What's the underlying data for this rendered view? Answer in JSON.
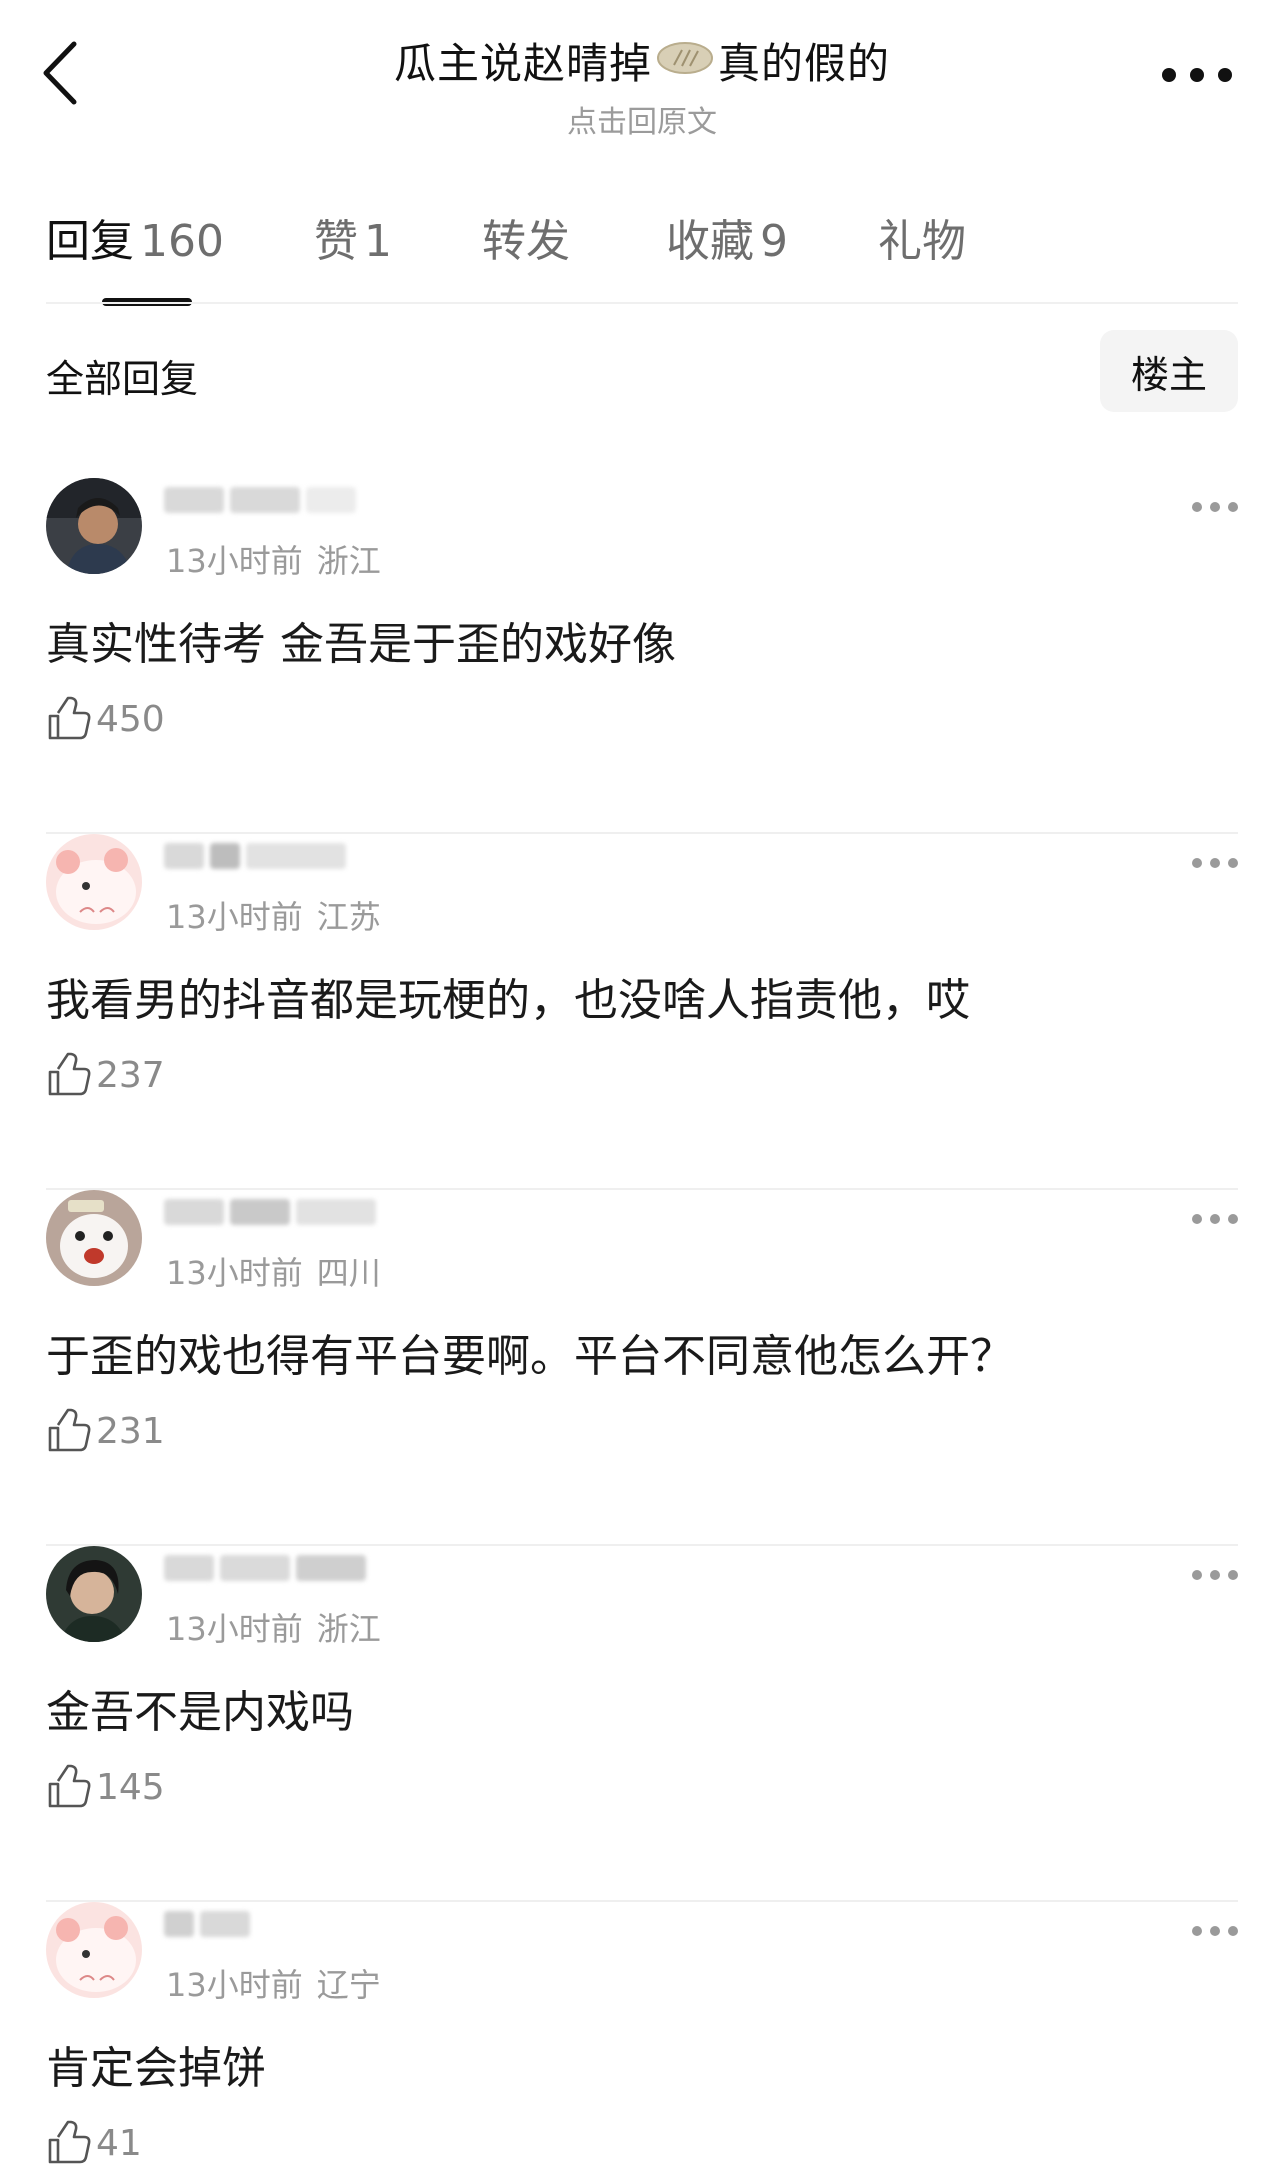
{
  "header": {
    "title_part1": "瓜主说赵晴掉",
    "title_icon": "bread-icon",
    "title_part2": "真的假的",
    "subtitle": "点击回原文"
  },
  "tabs": [
    {
      "label": "回复",
      "count": "160",
      "active": true
    },
    {
      "label": "赞",
      "count": "1"
    },
    {
      "label": "转发",
      "count": ""
    },
    {
      "label": "收藏",
      "count": "9"
    },
    {
      "label": "礼物",
      "count": ""
    }
  ],
  "filter": {
    "title": "全部回复",
    "op_button": "楼主"
  },
  "comments": [
    {
      "time": "13小时前",
      "location": "浙江",
      "text": "真实性待考 金吾是于歪的戏好像",
      "likes": "450",
      "avatar_icon": "person-photo-avatar"
    },
    {
      "time": "13小时前",
      "location": "江苏",
      "text": "我看男的抖音都是玩梗的，也没啥人指责他，哎",
      "likes": "237",
      "avatar_icon": "cartoon-bear-avatar"
    },
    {
      "time": "13小时前",
      "location": "四川",
      "text": "于歪的戏也得有平台要啊。平台不同意他怎么开？",
      "likes": "231",
      "avatar_icon": "white-dog-avatar"
    },
    {
      "time": "13小时前",
      "location": "浙江",
      "text": "金吾不是内戏吗",
      "likes": "145",
      "avatar_icon": "person-photo-avatar"
    },
    {
      "time": "13小时前",
      "location": "辽宁",
      "text": "肯定会掉饼",
      "likes": "41",
      "avatar_icon": "cartoon-bear-avatar"
    }
  ]
}
